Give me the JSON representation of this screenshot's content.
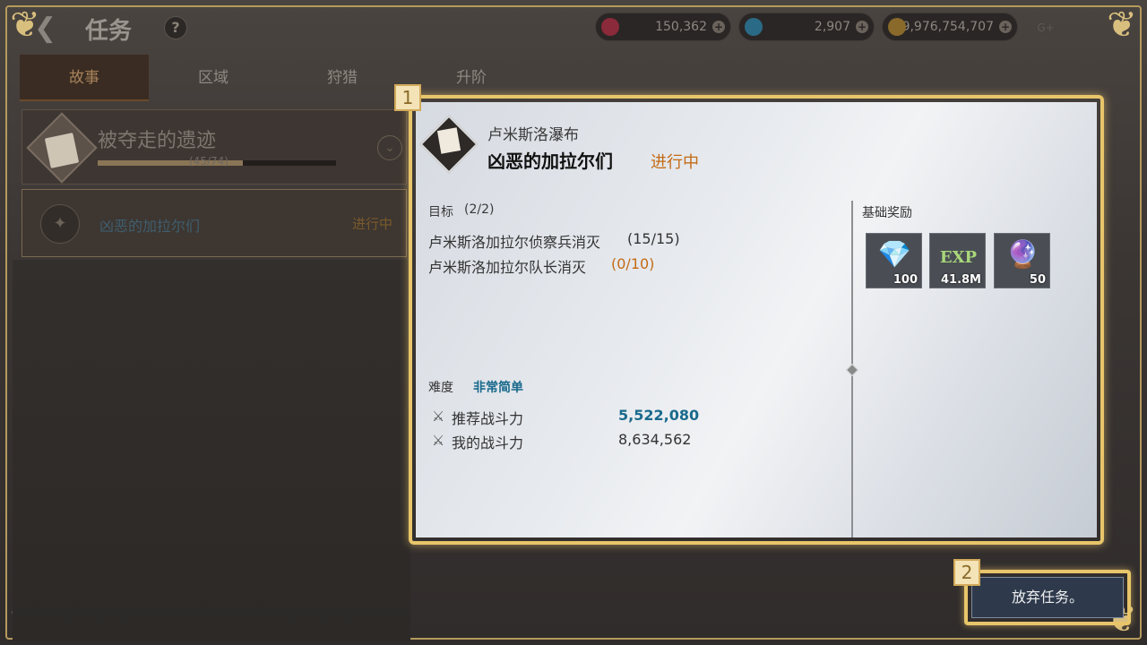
{
  "header": {
    "title": "任务",
    "help": "?",
    "currencies": [
      {
        "icon": "ruby-icon",
        "value": "150,362"
      },
      {
        "icon": "diamond-icon",
        "value": "2,907"
      },
      {
        "icon": "gold-coin-icon",
        "value": "9,976,754,707"
      }
    ],
    "gplus": "G+"
  },
  "tabs": [
    "故事",
    "区域",
    "狩猎",
    "升阶"
  ],
  "chapter": {
    "title": "被夺走的遗迹",
    "progress_text": "(45/74)",
    "progress": 0.608
  },
  "quest_list_item": {
    "name": "凶恶的加拉尔们",
    "status": "进行中"
  },
  "detail": {
    "location": "卢米斯洛瀑布",
    "quest_name": "凶恶的加拉尔们",
    "state": "进行中",
    "objective_label": "目标",
    "objective_count": "(2/2)",
    "objectives": [
      {
        "text": "卢米斯洛加拉尔侦察兵消灭",
        "progress": "(15/15)"
      },
      {
        "text": "卢米斯洛加拉尔队长消灭",
        "progress": "(0/10)"
      }
    ],
    "difficulty_label": "难度",
    "difficulty_value": "非常简单",
    "recommended_label": "推荐战斗力",
    "recommended_value": "5,522,080",
    "my_power_label": "我的战斗力",
    "my_power_value": "8,634,562",
    "reward_label": "基础奖励",
    "rewards": [
      {
        "icon": "diamond-icon",
        "glyph": "💎",
        "value": "100"
      },
      {
        "icon": "exp-icon",
        "glyph": "EXP",
        "value": "41.8M"
      },
      {
        "icon": "orb-icon",
        "glyph": "🔮",
        "value": "50"
      }
    ]
  },
  "tutorial_markers": [
    "1",
    "2"
  ],
  "abandon_button": "放弃任务。",
  "colors": {
    "accent_gold": "#e8c56a",
    "in_progress": "#c36b14",
    "value_blue": "#1a6a8c"
  }
}
